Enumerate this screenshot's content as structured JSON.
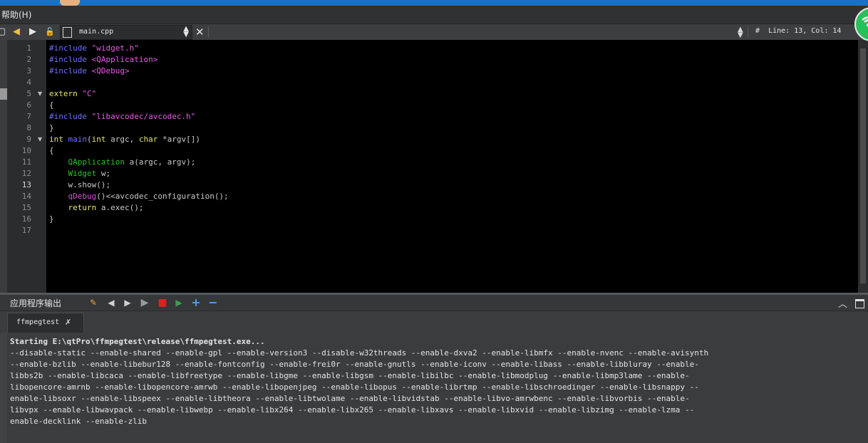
{
  "menu": {
    "help_label": "帮助(H)"
  },
  "toolbar": {
    "file_name": "main.cpp",
    "line_info": "Line: 13, Col: 14",
    "line_info_prefix": "#"
  },
  "editor": {
    "current_line": 13,
    "line_numbers": [
      "1",
      "2",
      "3",
      "4",
      "5",
      "6",
      "7",
      "8",
      "9",
      "10",
      "11",
      "12",
      "13",
      "14",
      "15",
      "16",
      "17"
    ],
    "fold_markers": [
      "5",
      "9"
    ],
    "lines": [
      "#include \"widget.h\"",
      "#include <QApplication>",
      "#include <QDebug>",
      "",
      "extern \"C\"",
      "{",
      "#include \"libavcodec/avcodec.h\"",
      "}",
      "int main(int argc, char *argv[])",
      "{",
      "    QApplication a(argc, argv);",
      "    Widget w;",
      "    w.show();",
      "    qDebug()<<avcodec_configuration();",
      "    return a.exec();",
      "}",
      ""
    ]
  },
  "output_pane": {
    "title": "应用程序输出",
    "tab_label": "ffmpegtest",
    "lines": [
      "Starting E:\\qtPro\\ffmpegtest\\release\\ffmpegtest.exe...",
      "--disable-static --enable-shared --enable-gpl --enable-version3 --disable-w32threads --enable-dxva2 --enable-libmfx --enable-nvenc --enable-avisynth",
      "--enable-bzlib --enable-libebur128 --enable-fontconfig --enable-frei0r --enable-gnutls --enable-iconv --enable-libass --enable-libbluray --enable-",
      "libbs2b --enable-libcaca --enable-libfreetype --enable-libgme --enable-libgsm --enable-libilbc --enable-libmodplug --enable-libmp3lame --enable-",
      "libopencore-amrnb --enable-libopencore-amrwb --enable-libopenjpeg --enable-libopus --enable-librtmp --enable-libschroedinger --enable-libsnappy --",
      "enable-libsoxr --enable-libspeex --enable-libtheora --enable-libtwolame --enable-libvidstab --enable-libvo-amrwbenc --enable-libvorbis --enable-",
      "libvpx --enable-libwavpack --enable-libwebp --enable-libx264 --enable-libx265 --enable-libxavs --enable-libxvid --enable-libzimg --enable-lzma --",
      "enable-decklink --enable-zlib"
    ]
  },
  "colors": {
    "keyword": "#7070ff",
    "keyword_alt": "#e8e86a",
    "string": "#e85be8",
    "class": "#c34cc3",
    "function": "#2cc22c",
    "editor_bg": "#000000",
    "pane_bg": "#3b3c3e"
  },
  "icons": {
    "back": "arrow-left-icon",
    "forward": "arrow-right-icon",
    "lock": "lock-icon",
    "file": "file-icon",
    "close": "close-icon",
    "output_toolbar": [
      "attach-debugger-icon",
      "previous-icon",
      "next-icon",
      "run-icon",
      "stop-icon",
      "rerun-icon",
      "zoom-in-icon",
      "zoom-out-icon"
    ],
    "wifi": "wifi-icon"
  }
}
